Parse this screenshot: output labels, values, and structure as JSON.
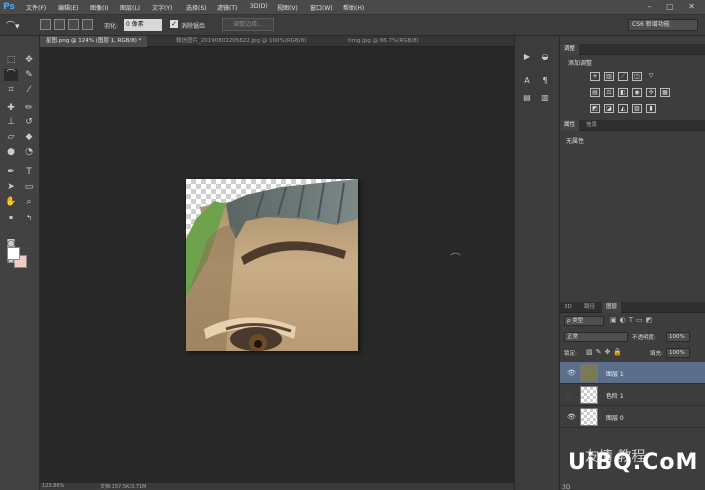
{
  "app": {
    "logo": "Ps",
    "window_controls": "–  ▢  ✕"
  },
  "menu": [
    "文件(F)",
    "编辑(E)",
    "图像(I)",
    "图层(L)",
    "文字(Y)",
    "选择(S)",
    "滤镜(T)",
    "3D(D)",
    "视图(V)",
    "窗口(W)",
    "帮助(H)"
  ],
  "options": {
    "feather_label": "羽化:",
    "feather_value": "0 像素",
    "antialias_label": "消除锯齿",
    "antialias_checked": true,
    "refine_edge": "调整边缘...",
    "workspace": "CS6 新增功能"
  },
  "tabs": [
    {
      "label": "星图.png @ 124% (图层 1, RGB/8) *",
      "active": true
    },
    {
      "label": "微信图片_20190802205822.jpg @ 100%(RGB/8)",
      "active": false
    },
    {
      "label": "timg.jpg @ 86.7%(RGB/8)",
      "active": false
    }
  ],
  "status": {
    "zoom": "123.86%",
    "doc": "文档:157.5K/3.71M"
  },
  "adjustments": {
    "tab": "调整",
    "title": "添加调整"
  },
  "properties": {
    "tabs": [
      "属性",
      "信息"
    ],
    "content": "无属性"
  },
  "layers_panel": {
    "tabs": [
      "3D",
      "路径",
      "图层"
    ],
    "filter": "ρ 类型",
    "blend_mode": "正常",
    "opacity_label": "不透明度:",
    "opacity_value": "100%",
    "lock_label": "锁定:",
    "fill_label": "填充:",
    "fill_value": "100%",
    "layers": [
      {
        "name": "图层 1",
        "visible": true,
        "active": true
      },
      {
        "name": "色阶 1",
        "visible": false,
        "active": false
      },
      {
        "name": "图层 0",
        "visible": true,
        "active": false
      }
    ]
  },
  "watermark": {
    "text": "UiBQ.CoM",
    "cn": "友情 教程"
  },
  "bottom_tab": "3D"
}
